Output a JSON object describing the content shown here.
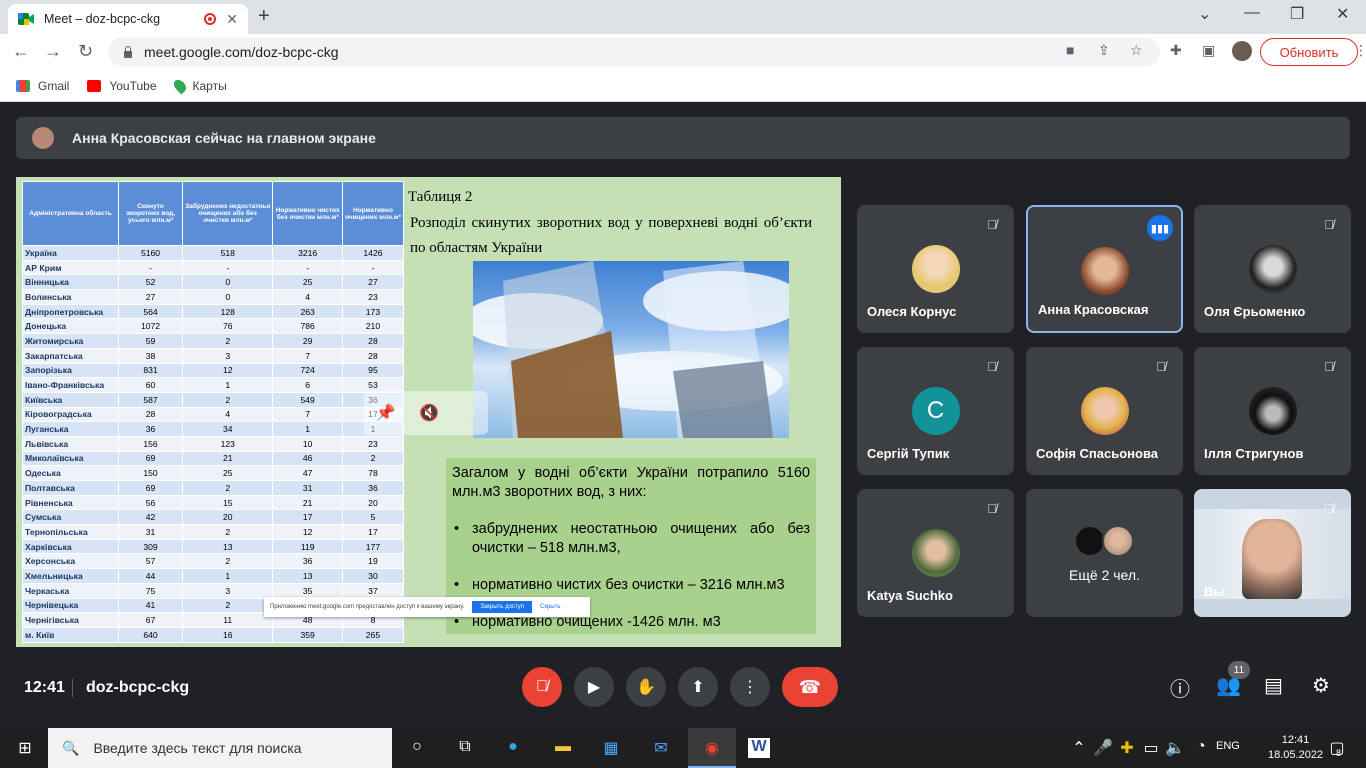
{
  "browser": {
    "tab_title": "Meet – doz-bcpc-ckg",
    "url": "meet.google.com/doz-bcpc-ckg",
    "update_label": "Обновить",
    "bookmarks": [
      {
        "label": "Gmail",
        "icon": "gmail-icon",
        "color": "#ea4335"
      },
      {
        "label": "YouTube",
        "icon": "youtube-icon",
        "color": "#ff0000"
      },
      {
        "label": "Карты",
        "icon": "maps-icon",
        "color": "#34a853"
      }
    ]
  },
  "meet": {
    "banner": "Анна Красовская сейчас на главном экране",
    "time": "12:41",
    "meeting_code": "doz-bcpc-ckg",
    "participants_count": "11",
    "slide": {
      "caption": "Таблиця 2",
      "title": "Розподіл скинутих зворотних вод у поверхневі водні об’єкти по областям України",
      "table_headers": [
        "Адміністративна область",
        "Скинуто зворотних вод, усього млн.м³",
        "Забруднених недостатньо очищених або без очистки млн.м³",
        "Нормативно чистих без очистки млн.м³",
        "Нормативно очищених млн.м³"
      ],
      "rows": [
        [
          "Україна",
          "5160",
          "518",
          "3216",
          "1426"
        ],
        [
          "АР Крим",
          "-",
          "-",
          "-",
          "-"
        ],
        [
          "Вінницька",
          "52",
          "0",
          "25",
          "27"
        ],
        [
          "Волинська",
          "27",
          "0",
          "4",
          "23"
        ],
        [
          "Дніпропетровська",
          "564",
          "128",
          "263",
          "173"
        ],
        [
          "Донецька",
          "1072",
          "76",
          "786",
          "210"
        ],
        [
          "Житомирська",
          "59",
          "2",
          "29",
          "28"
        ],
        [
          "Закарпатська",
          "38",
          "3",
          "7",
          "28"
        ],
        [
          "Запорізька",
          "831",
          "12",
          "724",
          "95"
        ],
        [
          "Івано-Франківська",
          "60",
          "1",
          "6",
          "53"
        ],
        [
          "Київська",
          "587",
          "2",
          "549",
          "36"
        ],
        [
          "Кіровоградська",
          "28",
          "4",
          "7",
          "17"
        ],
        [
          "Луганська",
          "36",
          "34",
          "1",
          "1"
        ],
        [
          "Львівська",
          "156",
          "123",
          "10",
          "23"
        ],
        [
          "Миколаївська",
          "69",
          "21",
          "46",
          "2"
        ],
        [
          "Одеська",
          "150",
          "25",
          "47",
          "78"
        ],
        [
          "Полтавська",
          "69",
          "2",
          "31",
          "36"
        ],
        [
          "Рівненська",
          "56",
          "15",
          "21",
          "20"
        ],
        [
          "Сумська",
          "42",
          "20",
          "17",
          "5"
        ],
        [
          "Тернопільська",
          "31",
          "2",
          "12",
          "17"
        ],
        [
          "Харківська",
          "309",
          "13",
          "119",
          "177"
        ],
        [
          "Херсонська",
          "57",
          "2",
          "36",
          "19"
        ],
        [
          "Хмельницька",
          "44",
          "1",
          "13",
          "30"
        ],
        [
          "Черкаська",
          "75",
          "3",
          "35",
          "37"
        ],
        [
          "Чернівецька",
          "41",
          "2",
          "",
          ""
        ],
        [
          "Чернігівська",
          "67",
          "11",
          "48",
          "8"
        ],
        [
          "м. Київ",
          "640",
          "16",
          "359",
          "265"
        ]
      ],
      "summary": "Загалом у водні об’єкти України потрапило 5160 млн.м3 зворотних вод, з них:",
      "bullets": [
        "забруднених неостатньою очищених або без очистки – 518 млн.м3,",
        "нормативно чистих без очистки – 3216 млн.м3",
        "нормативно очищених -1426 млн. м3"
      ],
      "share_notice": "Приложению meet.google.com предоставлен доступ к вашему экрану.",
      "share_stop": "Закрыть доступ",
      "share_hide": "Скрыть"
    },
    "tiles": [
      {
        "name": "Олеся Корнус",
        "initial": ""
      },
      {
        "name": "Анна Красовская",
        "initial": ""
      },
      {
        "name": "Оля Єрьоменко",
        "initial": ""
      },
      {
        "name": "Сергій Тупик",
        "initial": "С"
      },
      {
        "name": "Софія Спасьонова",
        "initial": ""
      },
      {
        "name": "Ілля Стригунов",
        "initial": ""
      },
      {
        "name": "Katya Suchko",
        "initial": ""
      },
      {
        "name": "Ещё 2 чел.",
        "initial": ""
      },
      {
        "name": "Вы",
        "initial": ""
      }
    ]
  },
  "taskbar": {
    "search_placeholder": "Введите здесь текст для поиска",
    "lang": "ENG",
    "time": "12:41",
    "date": "18.05.2022",
    "notif": "8"
  }
}
